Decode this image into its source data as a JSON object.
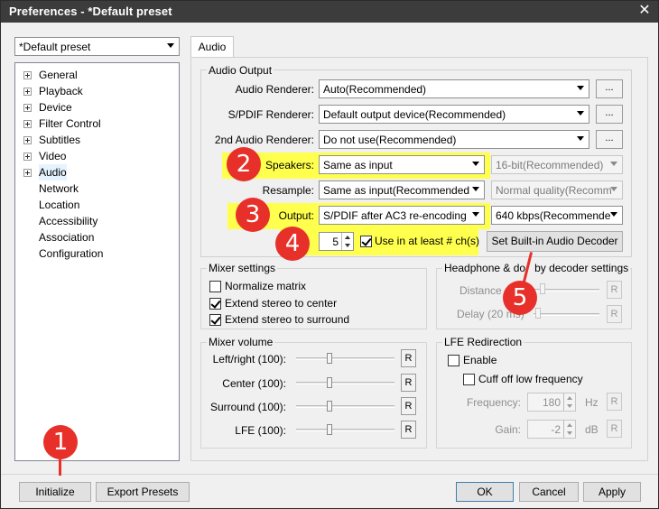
{
  "window": {
    "title": "Preferences - *Default preset"
  },
  "preset_combo": {
    "value": "*Default preset"
  },
  "tree": {
    "items": [
      {
        "label": "General",
        "expandable": true
      },
      {
        "label": "Playback",
        "expandable": true
      },
      {
        "label": "Device",
        "expandable": true
      },
      {
        "label": "Filter Control",
        "expandable": true
      },
      {
        "label": "Subtitles",
        "expandable": true
      },
      {
        "label": "Video",
        "expandable": true
      },
      {
        "label": "Audio",
        "expandable": true
      },
      {
        "label": "Network",
        "expandable": false
      },
      {
        "label": "Location",
        "expandable": false
      },
      {
        "label": "Accessibility",
        "expandable": false
      },
      {
        "label": "Association",
        "expandable": false
      },
      {
        "label": "Configuration",
        "expandable": false
      }
    ]
  },
  "tabs": {
    "audio": "Audio"
  },
  "audio_output": {
    "group_title": "Audio Output",
    "renderer_label": "Audio Renderer:",
    "renderer_value": "Auto(Recommended)",
    "spdif_label": "S/PDIF Renderer:",
    "spdif_value": "Default output device(Recommended)",
    "second_label": "2nd Audio Renderer:",
    "second_value": "Do not use(Recommended)",
    "more_button": "...",
    "speakers_label": "Speakers:",
    "speakers_value": "Same as input",
    "bitdepth_value": "16-bit(Recommended)",
    "resample_label": "Resample:",
    "resample_value": "Same as input(Recommended",
    "quality_value": "Normal quality(Recomm",
    "output_label": "Output:",
    "output_value": "S/PDIF after AC3 re-encoding",
    "bitrate_value": "640 kbps(Recommende",
    "channels_value": "5",
    "use_channels_label": "Use in at least # ch(s)",
    "decoder_button": "Set Built-in Audio Decoder"
  },
  "mixer_settings": {
    "title": "Mixer settings",
    "normalize": "Normalize matrix",
    "extend_center": "Extend stereo to center",
    "extend_surround": "Extend stereo to surround"
  },
  "mixer_volume": {
    "title": "Mixer volume",
    "left_right": "Left/right (100):",
    "center": "Center (100):",
    "surround": "Surround (100):",
    "lfe": "LFE (100):",
    "reset": "R"
  },
  "headphone": {
    "title": "Headphone & dolby decoder settings",
    "title_visible": "Headphone & do",
    "title_tail": "by decoder settings",
    "distance": "Distance (1",
    "delay": "Delay (20 ms)",
    "reset": "R"
  },
  "lfe_redirection": {
    "title": "LFE Redirection",
    "enable": "Enable",
    "cutoff": "Cuff off low frequency",
    "frequency_label": "Frequency:",
    "frequency_value": "180",
    "frequency_unit": "Hz",
    "gain_label": "Gain:",
    "gain_value": "-2",
    "gain_unit": "dB",
    "reset": "R"
  },
  "bottom": {
    "initialize": "Initialize",
    "export": "Export Presets",
    "ok": "OK",
    "cancel": "Cancel",
    "apply": "Apply"
  },
  "annotations": [
    "1",
    "2",
    "3",
    "4",
    "5"
  ],
  "colors": {
    "highlight": "#ffff4d",
    "badge": "#e8302a",
    "titlebar": "#3c3c3c"
  }
}
